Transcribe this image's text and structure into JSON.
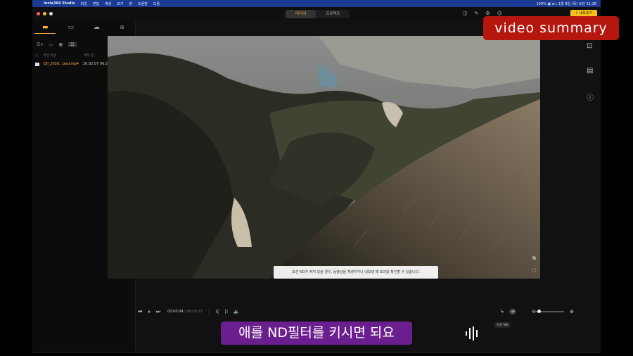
{
  "menubar": {
    "app_name": "Insta360 Studio",
    "menus": [
      "파일",
      "편집",
      "재생",
      "보기",
      "창",
      "도움말",
      "도움"
    ],
    "status": "100% ▣ ▰▱ 1월 8일 (목) 오전 11:38"
  },
  "toolbar": {
    "tabs": [
      {
        "label": "미디어",
        "active": true
      },
      {
        "label": "프로젝트",
        "active": false
      }
    ],
    "export_label": "⇪ 내보내기"
  },
  "left_panel": {
    "header_name": "파일 이름",
    "header_date": "제작 일",
    "file": {
      "name": "DJI_2026...ized.mp4",
      "date": "26.02.07 06:35"
    }
  },
  "preview": {
    "subtitle_text": "모션 ND가 켜져 있을 경우, 동영상을 재생하거나 내보낼 때 효과를 확인할 수 있습니다."
  },
  "playback": {
    "current_time": "00:00:04",
    "total_time": "/ 00:00:13",
    "motion_nd_label": "모션 ND"
  },
  "overlays": {
    "caption": "애를 ND필터를 키시면 되요",
    "video_summary": "video summary"
  },
  "colors": {
    "accent": "#ffb347",
    "export_button": "#f6c21a",
    "caption_bg": "#6b1f8e",
    "summary_bg": "#b5170f",
    "menubar": "#1b3a93"
  },
  "icons": [
    "apple-icon",
    "media-icon",
    "folder-icon",
    "cloud-icon",
    "import-icon",
    "plus-icon",
    "play-pause-icon",
    "skip-back-icon",
    "skip-forward-icon",
    "volume-icon",
    "zoom-in-icon",
    "zoom-out-icon",
    "fullscreen-icon",
    "pip-icon",
    "info-icon",
    "crop-icon",
    "flash-icon",
    "motion-nd-icon"
  ]
}
